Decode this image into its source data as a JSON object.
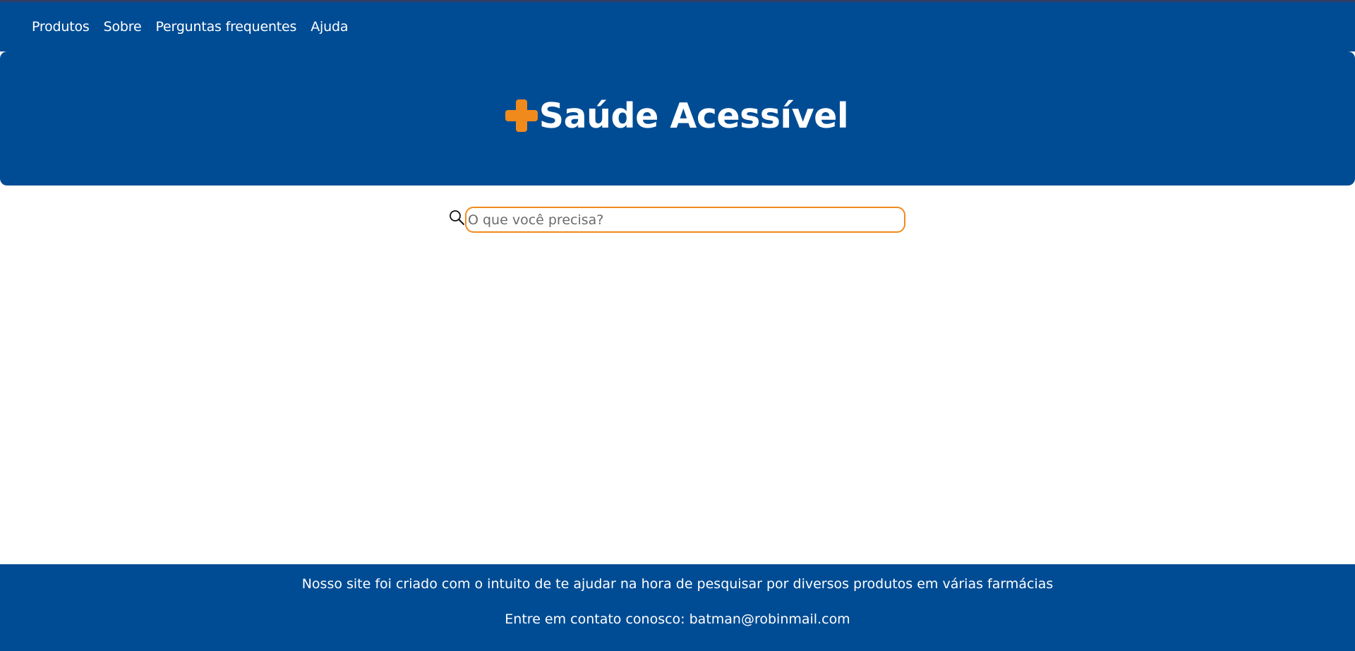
{
  "nav": {
    "items": [
      {
        "label": "Produtos"
      },
      {
        "label": "Sobre"
      },
      {
        "label": "Perguntas frequentes"
      },
      {
        "label": "Ajuda"
      }
    ]
  },
  "hero": {
    "title": "Saúde Acessível",
    "logo_icon": "plus-cross-icon"
  },
  "search": {
    "placeholder": "O que você precisa?",
    "value": "",
    "icon": "search-icon"
  },
  "footer": {
    "about_text": "Nosso site foi criado com o intuito de te ajudar na hora de pesquisar por diversos produtos em várias farmácias",
    "contact_text": "Entre em contato conosco: batman@robinmail.com"
  },
  "colors": {
    "brand_blue": "#004c94",
    "accent_orange": "#f08a1c",
    "text_white": "#ffffff"
  }
}
